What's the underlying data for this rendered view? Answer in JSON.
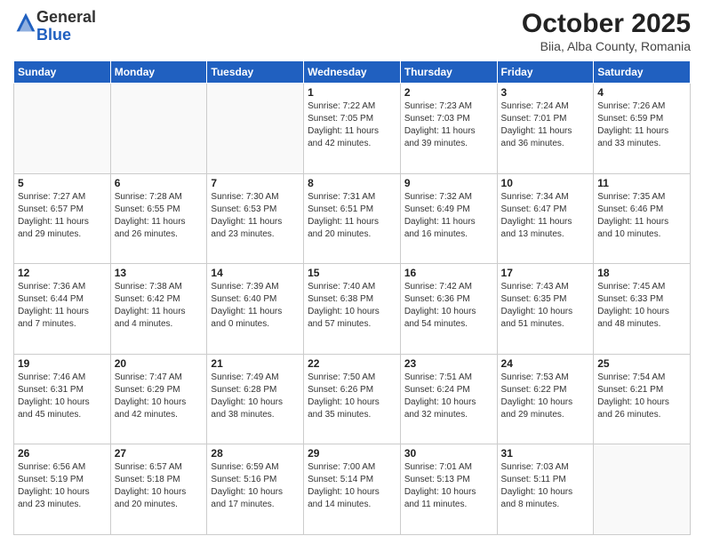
{
  "logo": {
    "general": "General",
    "blue": "Blue"
  },
  "title": "October 2025",
  "subtitle": "Biia, Alba County, Romania",
  "days_of_week": [
    "Sunday",
    "Monday",
    "Tuesday",
    "Wednesday",
    "Thursday",
    "Friday",
    "Saturday"
  ],
  "weeks": [
    [
      {
        "day": "",
        "info": ""
      },
      {
        "day": "",
        "info": ""
      },
      {
        "day": "",
        "info": ""
      },
      {
        "day": "1",
        "info": "Sunrise: 7:22 AM\nSunset: 7:05 PM\nDaylight: 11 hours\nand 42 minutes."
      },
      {
        "day": "2",
        "info": "Sunrise: 7:23 AM\nSunset: 7:03 PM\nDaylight: 11 hours\nand 39 minutes."
      },
      {
        "day": "3",
        "info": "Sunrise: 7:24 AM\nSunset: 7:01 PM\nDaylight: 11 hours\nand 36 minutes."
      },
      {
        "day": "4",
        "info": "Sunrise: 7:26 AM\nSunset: 6:59 PM\nDaylight: 11 hours\nand 33 minutes."
      }
    ],
    [
      {
        "day": "5",
        "info": "Sunrise: 7:27 AM\nSunset: 6:57 PM\nDaylight: 11 hours\nand 29 minutes."
      },
      {
        "day": "6",
        "info": "Sunrise: 7:28 AM\nSunset: 6:55 PM\nDaylight: 11 hours\nand 26 minutes."
      },
      {
        "day": "7",
        "info": "Sunrise: 7:30 AM\nSunset: 6:53 PM\nDaylight: 11 hours\nand 23 minutes."
      },
      {
        "day": "8",
        "info": "Sunrise: 7:31 AM\nSunset: 6:51 PM\nDaylight: 11 hours\nand 20 minutes."
      },
      {
        "day": "9",
        "info": "Sunrise: 7:32 AM\nSunset: 6:49 PM\nDaylight: 11 hours\nand 16 minutes."
      },
      {
        "day": "10",
        "info": "Sunrise: 7:34 AM\nSunset: 6:47 PM\nDaylight: 11 hours\nand 13 minutes."
      },
      {
        "day": "11",
        "info": "Sunrise: 7:35 AM\nSunset: 6:46 PM\nDaylight: 11 hours\nand 10 minutes."
      }
    ],
    [
      {
        "day": "12",
        "info": "Sunrise: 7:36 AM\nSunset: 6:44 PM\nDaylight: 11 hours\nand 7 minutes."
      },
      {
        "day": "13",
        "info": "Sunrise: 7:38 AM\nSunset: 6:42 PM\nDaylight: 11 hours\nand 4 minutes."
      },
      {
        "day": "14",
        "info": "Sunrise: 7:39 AM\nSunset: 6:40 PM\nDaylight: 11 hours\nand 0 minutes."
      },
      {
        "day": "15",
        "info": "Sunrise: 7:40 AM\nSunset: 6:38 PM\nDaylight: 10 hours\nand 57 minutes."
      },
      {
        "day": "16",
        "info": "Sunrise: 7:42 AM\nSunset: 6:36 PM\nDaylight: 10 hours\nand 54 minutes."
      },
      {
        "day": "17",
        "info": "Sunrise: 7:43 AM\nSunset: 6:35 PM\nDaylight: 10 hours\nand 51 minutes."
      },
      {
        "day": "18",
        "info": "Sunrise: 7:45 AM\nSunset: 6:33 PM\nDaylight: 10 hours\nand 48 minutes."
      }
    ],
    [
      {
        "day": "19",
        "info": "Sunrise: 7:46 AM\nSunset: 6:31 PM\nDaylight: 10 hours\nand 45 minutes."
      },
      {
        "day": "20",
        "info": "Sunrise: 7:47 AM\nSunset: 6:29 PM\nDaylight: 10 hours\nand 42 minutes."
      },
      {
        "day": "21",
        "info": "Sunrise: 7:49 AM\nSunset: 6:28 PM\nDaylight: 10 hours\nand 38 minutes."
      },
      {
        "day": "22",
        "info": "Sunrise: 7:50 AM\nSunset: 6:26 PM\nDaylight: 10 hours\nand 35 minutes."
      },
      {
        "day": "23",
        "info": "Sunrise: 7:51 AM\nSunset: 6:24 PM\nDaylight: 10 hours\nand 32 minutes."
      },
      {
        "day": "24",
        "info": "Sunrise: 7:53 AM\nSunset: 6:22 PM\nDaylight: 10 hours\nand 29 minutes."
      },
      {
        "day": "25",
        "info": "Sunrise: 7:54 AM\nSunset: 6:21 PM\nDaylight: 10 hours\nand 26 minutes."
      }
    ],
    [
      {
        "day": "26",
        "info": "Sunrise: 6:56 AM\nSunset: 5:19 PM\nDaylight: 10 hours\nand 23 minutes."
      },
      {
        "day": "27",
        "info": "Sunrise: 6:57 AM\nSunset: 5:18 PM\nDaylight: 10 hours\nand 20 minutes."
      },
      {
        "day": "28",
        "info": "Sunrise: 6:59 AM\nSunset: 5:16 PM\nDaylight: 10 hours\nand 17 minutes."
      },
      {
        "day": "29",
        "info": "Sunrise: 7:00 AM\nSunset: 5:14 PM\nDaylight: 10 hours\nand 14 minutes."
      },
      {
        "day": "30",
        "info": "Sunrise: 7:01 AM\nSunset: 5:13 PM\nDaylight: 10 hours\nand 11 minutes."
      },
      {
        "day": "31",
        "info": "Sunrise: 7:03 AM\nSunset: 5:11 PM\nDaylight: 10 hours\nand 8 minutes."
      },
      {
        "day": "",
        "info": ""
      }
    ]
  ]
}
